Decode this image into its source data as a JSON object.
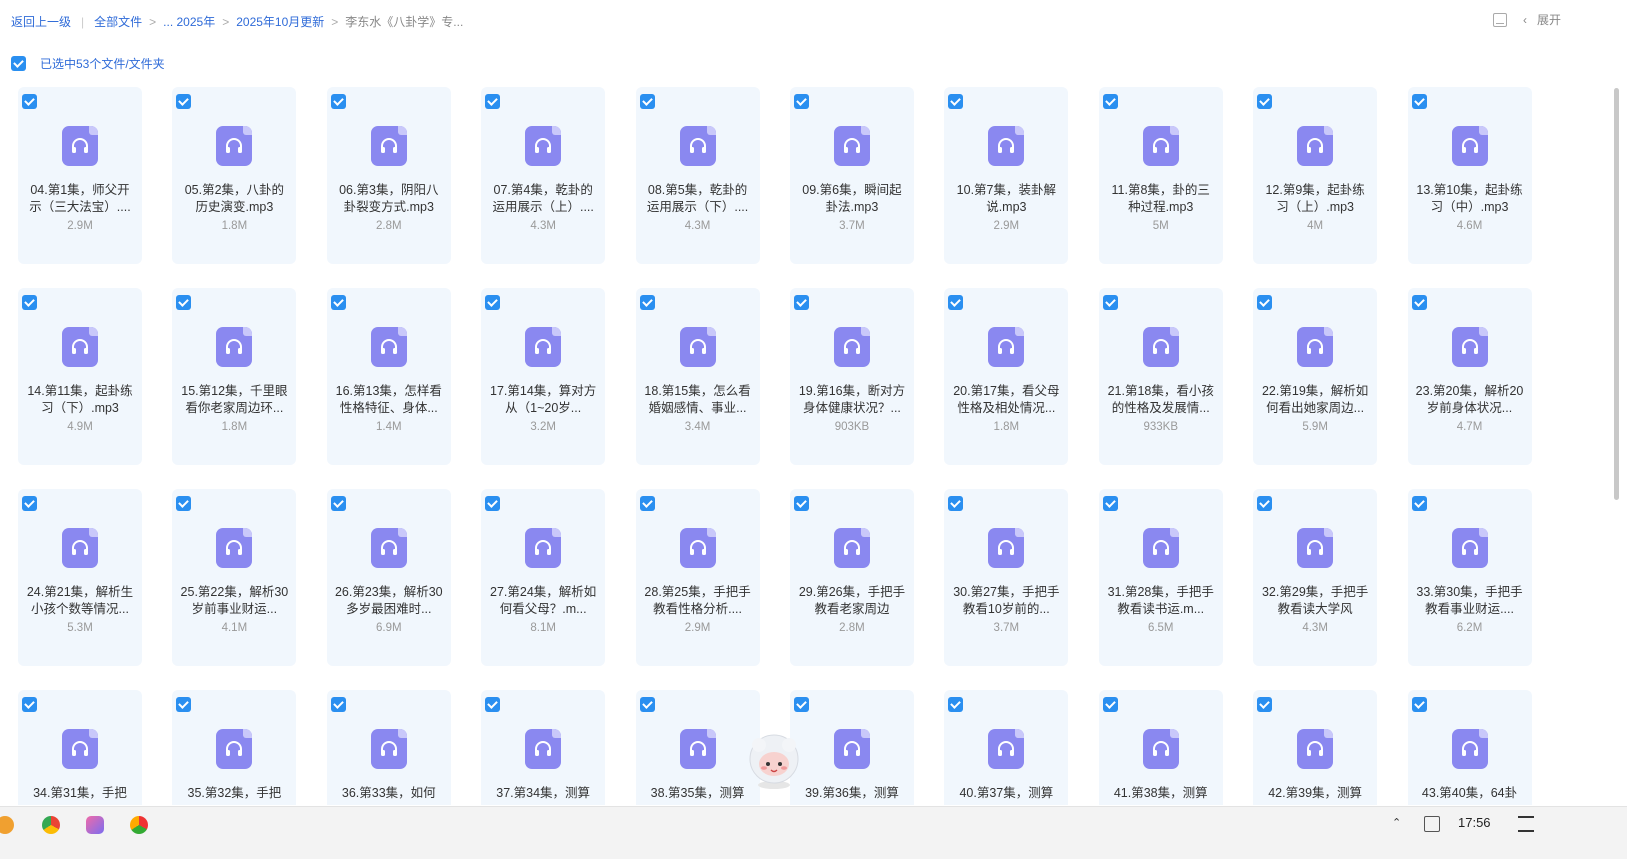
{
  "breadcrumb": {
    "back": "返回上一级",
    "root": "全部文件",
    "ellipsis_2025": "... 2025年",
    "folder": "2025年10月更新",
    "current": "李东水《八卦学》专..."
  },
  "top_right": {
    "expand_label": "展开"
  },
  "selection": {
    "label": "已选中53个文件/文件夹"
  },
  "files": [
    {
      "name": "04.第1集，师父开示（三大法宝）....",
      "size": "2.9M"
    },
    {
      "name": "05.第2集，八卦的历史演变.mp3",
      "size": "1.8M"
    },
    {
      "name": "06.第3集，阴阳八卦裂变方式.mp3",
      "size": "2.8M"
    },
    {
      "name": "07.第4集，乾卦的运用展示（上）....",
      "size": "4.3M"
    },
    {
      "name": "08.第5集，乾卦的运用展示（下）....",
      "size": "4.3M"
    },
    {
      "name": "09.第6集，瞬间起卦法.mp3",
      "size": "3.7M"
    },
    {
      "name": "10.第7集，装卦解说.mp3",
      "size": "2.9M"
    },
    {
      "name": "11.第8集，卦的三种过程.mp3",
      "size": "5M"
    },
    {
      "name": "12.第9集，起卦练习（上）.mp3",
      "size": "4M"
    },
    {
      "name": "13.第10集，起卦练习（中）.mp3",
      "size": "4.6M"
    },
    {
      "name": "14.第11集，起卦练习（下）.mp3",
      "size": "4.9M"
    },
    {
      "name": "15.第12集，千里眼看你老家周边环...",
      "size": "1.8M"
    },
    {
      "name": "16.第13集，怎样看性格特征、身体...",
      "size": "1.4M"
    },
    {
      "name": "17.第14集，算对方从（1~20岁...",
      "size": "3.2M"
    },
    {
      "name": "18.第15集，怎么看婚姻感情、事业...",
      "size": "3.4M"
    },
    {
      "name": "19.第16集，断对方身体健康状况？...",
      "size": "903KB"
    },
    {
      "name": "20.第17集，看父母性格及相处情况...",
      "size": "1.8M"
    },
    {
      "name": "21.第18集，看小孩的性格及发展情...",
      "size": "933KB"
    },
    {
      "name": "22.第19集，解析如何看出她家周边...",
      "size": "5.9M"
    },
    {
      "name": "23.第20集，解析20岁前身体状况...",
      "size": "4.7M"
    },
    {
      "name": "24.第21集，解析生小孩个数等情况...",
      "size": "5.3M"
    },
    {
      "name": "25.第22集，解析30岁前事业财运...",
      "size": "4.1M"
    },
    {
      "name": "26.第23集，解析30多岁最困难时...",
      "size": "6.9M"
    },
    {
      "name": "27.第24集，解析如何看父母？.m...",
      "size": "8.1M"
    },
    {
      "name": "28.第25集，手把手教看性格分析....",
      "size": "2.9M"
    },
    {
      "name": "29.第26集，手把手教看老家周边",
      "size": "2.8M"
    },
    {
      "name": "30.第27集，手把手教看10岁前的...",
      "size": "3.7M"
    },
    {
      "name": "31.第28集，手把手教看读书运.m...",
      "size": "6.5M"
    },
    {
      "name": "32.第29集，手把手教看读大学风",
      "size": "4.3M"
    },
    {
      "name": "33.第30集，手把手教看事业财运....",
      "size": "6.2M"
    },
    {
      "name": "34.第31集，手把",
      "size": ""
    },
    {
      "name": "35.第32集，手把",
      "size": ""
    },
    {
      "name": "36.第33集，如何",
      "size": ""
    },
    {
      "name": "37.第34集，测算",
      "size": ""
    },
    {
      "name": "38.第35集，测算",
      "size": ""
    },
    {
      "name": "39.第36集，测算",
      "size": ""
    },
    {
      "name": "40.第37集，测算",
      "size": ""
    },
    {
      "name": "41.第38集，测算",
      "size": ""
    },
    {
      "name": "42.第39集，测算",
      "size": ""
    },
    {
      "name": "43.第40集，64卦",
      "size": ""
    }
  ],
  "taskbar": {
    "time": "17:56"
  },
  "colors": {
    "accent": "#2a8ff0",
    "link": "#2f6bd8",
    "card_bg": "#f1f7fd",
    "audio_icon": "#8a88f0"
  }
}
